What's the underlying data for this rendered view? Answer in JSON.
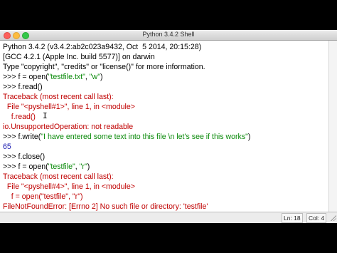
{
  "window": {
    "title": "Python 3.4.2 Shell"
  },
  "shell": {
    "banner1": "Python 3.4.2 (v3.4.2:ab2c023a9432, Oct  5 2014, 20:15:28)",
    "banner2": "[GCC 4.2.1 (Apple Inc. build 5577)] on darwin",
    "banner3": "Type \"copyright\", \"credits\" or \"license()\" for more information.",
    "prompt": ">>> ",
    "cmd1_pre": "f = open(",
    "cmd1_str1": "\"testfile.txt\"",
    "cmd1_mid": ", ",
    "cmd1_str2": "\"w\"",
    "cmd1_post": ")",
    "cmd2": "f.read()",
    "tb1_header": "Traceback (most recent call last):",
    "tb1_file": "  File \"<pyshell#1>\", line 1, in <module>",
    "tb1_code": "    f.read()",
    "tb1_error": "io.UnsupportedOperation: not readable",
    "cmd3_pre": "f.write(",
    "cmd3_str": "\"I have entered some text into this file \\n let's see if this works\"",
    "cmd3_post": ")",
    "out3": "65",
    "cmd4": "f.close()",
    "cmd5_pre": "f = open(",
    "cmd5_str1": "\"testfile\"",
    "cmd5_mid": ", ",
    "cmd5_str2": "\"r\"",
    "cmd5_post": ")",
    "tb2_header": "Traceback (most recent call last):",
    "tb2_file": "  File \"<pyshell#4>\", line 1, in <module>",
    "tb2_code": "    f = open(\"testfile\", \"r\")",
    "tb2_error": "FileNotFoundError: [Errno 2] No such file or directory: 'testfile'",
    "final_prompt": ">>> "
  },
  "status": {
    "line": "Ln: 18",
    "col": "Col: 4"
  },
  "colors": {
    "error": "#c00000",
    "string": "#0a8a0a",
    "output": "#1a1ab0"
  }
}
